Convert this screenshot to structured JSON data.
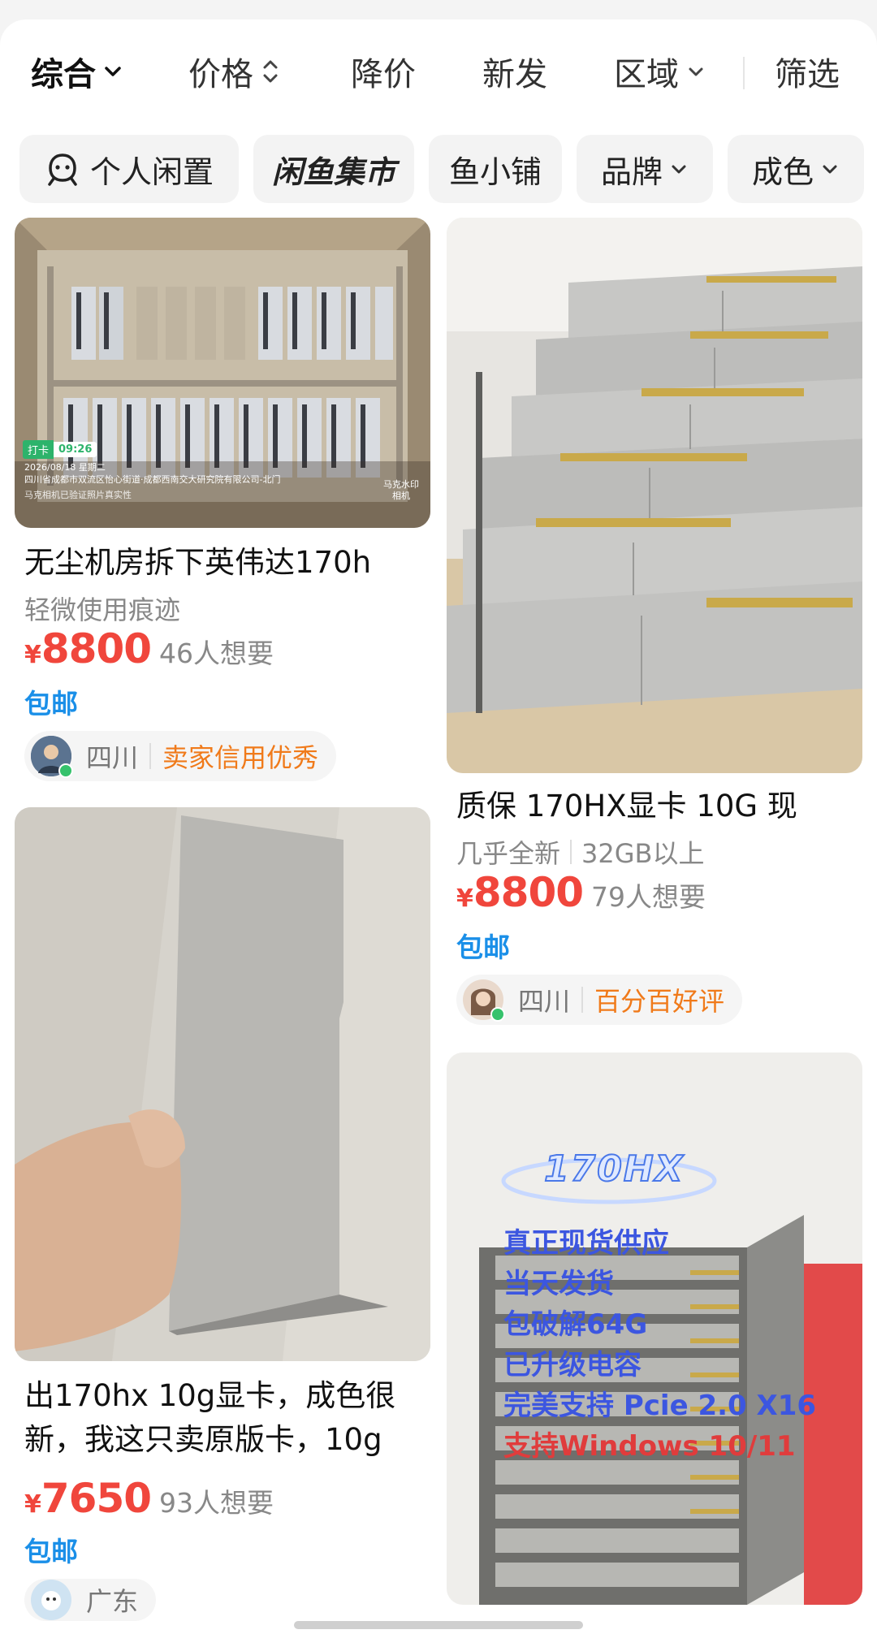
{
  "sort": {
    "items": [
      "综合",
      "价格",
      "降价",
      "新发",
      "区域"
    ],
    "filter": "筛选"
  },
  "chips": [
    "个人闲置",
    "闲鱼集市",
    "鱼小铺",
    "品牌",
    "成色"
  ],
  "products": [
    {
      "title": "无尘机房拆下英伟达170h",
      "condition": "轻微使用痕迹",
      "currency": "¥",
      "price": "8800",
      "wants": "46人想要",
      "shipping": "包邮",
      "location": "四川",
      "badge": "卖家信用优秀",
      "photo_tag_time": "09:26",
      "photo_tag_label": "打卡",
      "photo_date": "2026/08/18 星期二",
      "photo_address": "四川省成都市双流区怡心街道·成都西南交大研究院有限公司-北门",
      "photo_cam": "马克水印相机",
      "photo_verify": "马克相机已验证照片真实性"
    },
    {
      "title": "质保 170HX显卡 10G 现",
      "condition": "几乎全新",
      "spec": "32GB以上",
      "currency": "¥",
      "price": "8800",
      "wants": "79人想要",
      "shipping": "包邮",
      "location": "四川",
      "badge": "百分百好评"
    },
    {
      "title_line1": "出170hx 10g显卡，成色很",
      "title_line2": "新，我这只卖原版卡，10g",
      "currency": "¥",
      "price": "7650",
      "wants": "93人想要",
      "shipping": "包邮",
      "location": "广东"
    },
    {
      "overlay_brand": "170HX",
      "overlay_lines": [
        "真正现货供应",
        "当天发货",
        "包破解64G",
        "已升级电容",
        "完美支持 Pcie 2.0 X16",
        "支持Windows 10/11"
      ]
    }
  ]
}
